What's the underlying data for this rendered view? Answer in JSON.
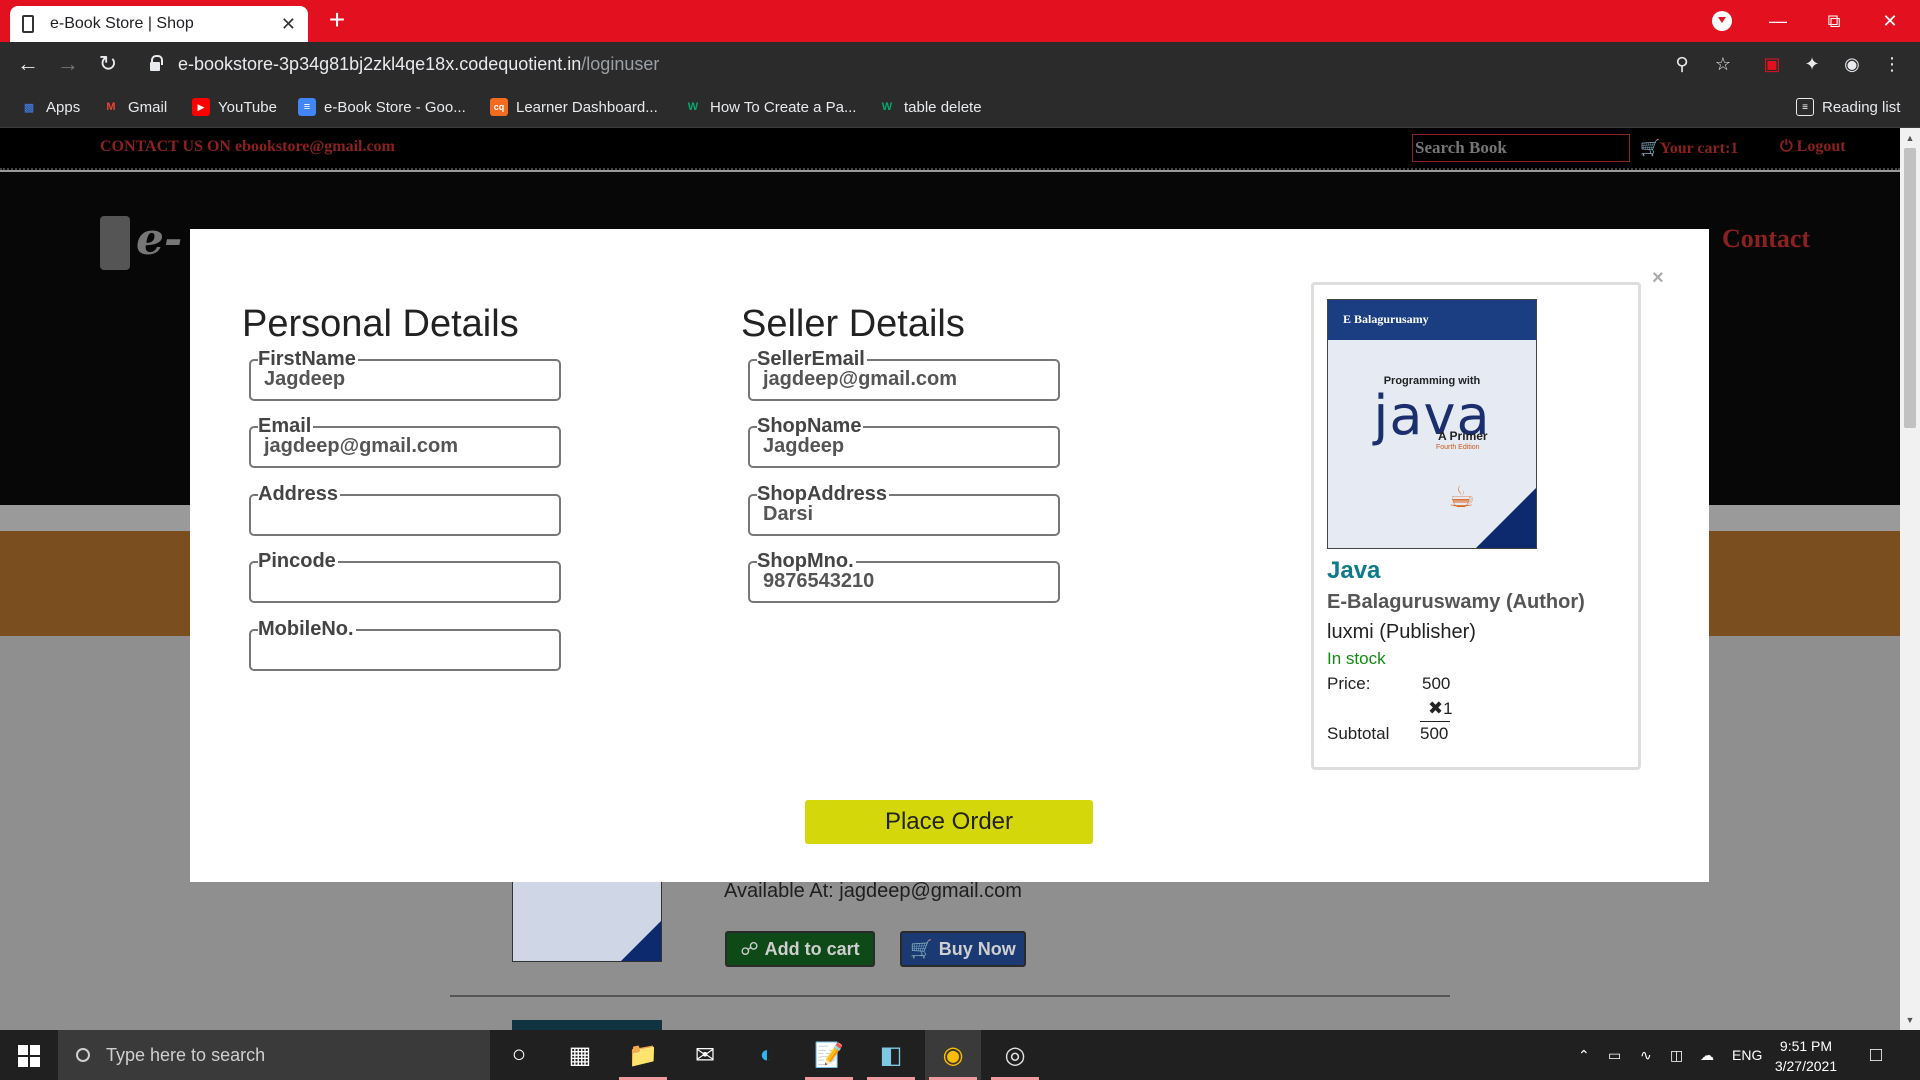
{
  "browser": {
    "tab_title": "e-Book Store | Shop",
    "tab_close": "✕",
    "new_tab": "+",
    "url_host": "e-bookstore-3p34g81bj2zkl4qe18x.codequotient.in",
    "url_path": "/loginuser",
    "bookmarks": [
      {
        "label": "Apps",
        "icon": "apps-grid-icon",
        "color": "#4285f4"
      },
      {
        "label": "Gmail",
        "icon": "gmail-icon",
        "color": "#ea4335"
      },
      {
        "label": "YouTube",
        "icon": "youtube-icon",
        "color": "#ff0000"
      },
      {
        "label": "e-Book Store - Goo...",
        "icon": "google-docs-icon",
        "color": "#4285f4"
      },
      {
        "label": "Learner Dashboard...",
        "icon": "codequotient-icon",
        "color": "#f26b21"
      },
      {
        "label": "How To Create a Pa...",
        "icon": "w3schools-icon",
        "color": "#04aa6d"
      },
      {
        "label": "table delete",
        "icon": "w3schools-icon",
        "color": "#04aa6d"
      }
    ],
    "reading_list": "Reading list"
  },
  "site": {
    "contact_us": "CONTACT US ON ebookstore@gmail.com",
    "search_placeholder": "Search Book",
    "cart": "Your cart:1",
    "logout": "Logout",
    "logo_text": "e-",
    "nav_contact": "Contact",
    "available_at": "Available At: jagdeep@gmail.com",
    "add_to_cart": "Add to cart",
    "buy_now": "Buy Now"
  },
  "modal": {
    "close": "×",
    "personal_heading": "Personal Details",
    "seller_heading": "Seller Details",
    "personal_fields": [
      {
        "label": "FirstName",
        "value": "Jagdeep"
      },
      {
        "label": "Email",
        "value": "jagdeep@gmail.com"
      },
      {
        "label": "Address",
        "value": ""
      },
      {
        "label": "Pincode",
        "value": ""
      },
      {
        "label": "MobileNo.",
        "value": ""
      }
    ],
    "seller_fields": [
      {
        "label": "SellerEmail",
        "value": "jagdeep@gmail.com"
      },
      {
        "label": "ShopName",
        "value": "Jagdeep"
      },
      {
        "label": "ShopAddress",
        "value": "Darsi"
      },
      {
        "label": "ShopMno.",
        "value": "9876543210"
      }
    ],
    "product": {
      "cover_author": "E Balagurusamy",
      "cover_subtitle": "Programming with",
      "cover_title": "java",
      "cover_primer": "A Primer",
      "cover_edition": "Fourth Edition",
      "title": "Java",
      "author": "E-Balaguruswamy (Author)",
      "publisher": "luxmi (Publisher)",
      "stock": "In stock",
      "price_label": "Price:",
      "price": "500",
      "qty_symbol": "✖",
      "qty": "1",
      "subtotal_label": "Subtotal",
      "subtotal": "500"
    },
    "place_order": "Place Order"
  },
  "taskbar": {
    "search_placeholder": "Type here to search",
    "language": "ENG",
    "time": "9:51 PM",
    "date": "3/27/2021"
  },
  "colors": {
    "chrome_red": "#e3101f",
    "place_order_bg": "#d4d80a",
    "product_title": "#0e7a8a",
    "in_stock": "#128a12",
    "site_accent": "#8b2020"
  }
}
